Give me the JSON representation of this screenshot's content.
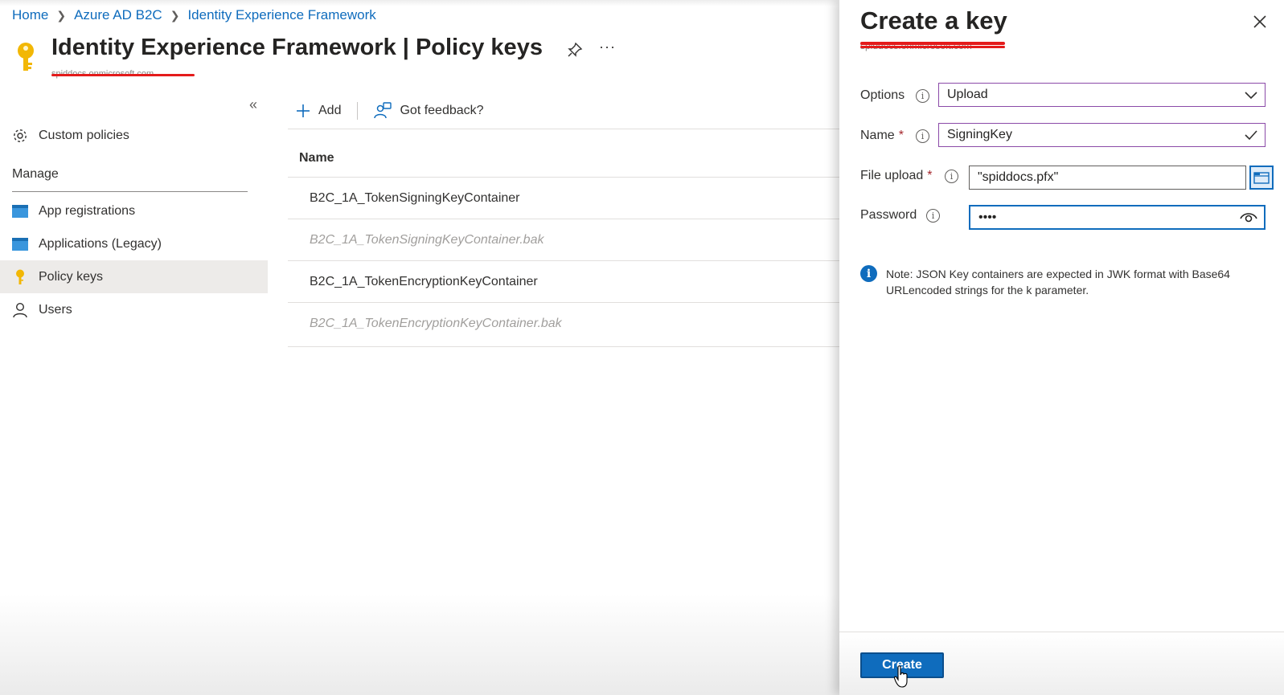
{
  "breadcrumb": {
    "items": [
      "Home",
      "Azure AD B2C",
      "Identity Experience Framework"
    ]
  },
  "header": {
    "title_bold": "Identity Experience Framework",
    "title_rest": " | Policy keys",
    "tenant": "spiddocs.onmicrosoft.com",
    "more": "···"
  },
  "nav": {
    "collapse": "«",
    "custom_policies": "Custom policies",
    "manage_heading": "Manage",
    "items": [
      {
        "label": "App registrations"
      },
      {
        "label": "Applications (Legacy)"
      },
      {
        "label": "Policy keys"
      },
      {
        "label": "Users"
      }
    ]
  },
  "toolbar": {
    "add_label": "Add",
    "feedback_label": "Got feedback?"
  },
  "table": {
    "header": "Name",
    "rows": [
      "B2C_1A_TokenSigningKeyContainer",
      "B2C_1A_TokenSigningKeyContainer.bak",
      "B2C_1A_TokenEncryptionKeyContainer",
      "B2C_1A_TokenEncryptionKeyContainer.bak"
    ]
  },
  "panel": {
    "title": "Create a key",
    "subtitle": "spiddocs.onmicrosoft.com",
    "options_label": "Options",
    "options_value": "Upload",
    "name_label": "Name",
    "name_value": "SigningKey",
    "file_label": "File upload",
    "file_value": "\"spiddocs.pfx\"",
    "password_label": "Password",
    "password_value": "••••",
    "required_marker": "*",
    "note": "Note: JSON Key containers are expected in JWK format with Base64 URLencoded strings for the k parameter.",
    "create_label": "Create"
  },
  "colors": {
    "accent": "#0f6cbd",
    "field_border": "#8b4aa8",
    "redaction": "#e41b1b"
  }
}
